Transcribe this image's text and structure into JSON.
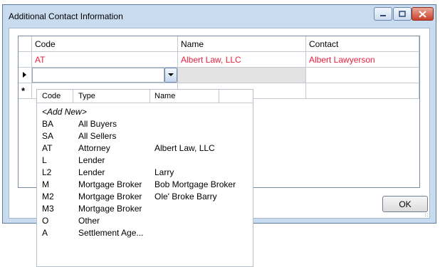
{
  "window": {
    "title": "Additional Contact Information"
  },
  "grid": {
    "columns": [
      "Code",
      "Name",
      "Contact"
    ],
    "rows": [
      {
        "code": "AT",
        "name": "Albert Law, LLC",
        "contact": "Albert Lawyerson"
      }
    ],
    "new_row_marker": "*"
  },
  "ok_label": "OK",
  "dropdown": {
    "columns": [
      "Code",
      "Type",
      "Name"
    ],
    "add_new_label": "<Add New>",
    "items": [
      {
        "code": "BA",
        "type": "All Buyers",
        "name": ""
      },
      {
        "code": "SA",
        "type": "All Sellers",
        "name": ""
      },
      {
        "code": "AT",
        "type": "Attorney",
        "name": "Albert Law, LLC"
      },
      {
        "code": "L",
        "type": "Lender",
        "name": ""
      },
      {
        "code": "L2",
        "type": "Lender",
        "name": "Larry"
      },
      {
        "code": "M",
        "type": "Mortgage Broker",
        "name": "Bob Mortgage Broker"
      },
      {
        "code": "M2",
        "type": "Mortgage Broker",
        "name": "Ole' Broke Barry"
      },
      {
        "code": "M3",
        "type": "Mortgage Broker",
        "name": ""
      },
      {
        "code": "O",
        "type": "Other",
        "name": ""
      },
      {
        "code": "A",
        "type": "Settlement Age...",
        "name": ""
      }
    ]
  },
  "colors": {
    "frame": "#c9dbef",
    "highlight_text": "#e8203f"
  }
}
